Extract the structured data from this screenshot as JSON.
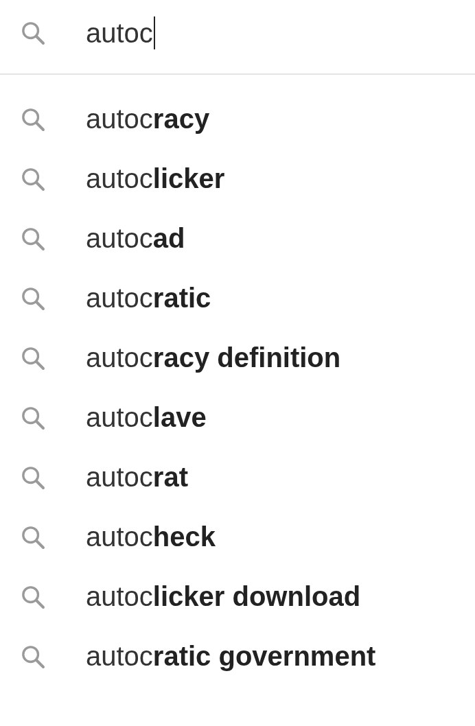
{
  "search": {
    "value": "autoc"
  },
  "suggestions": [
    "autoc**racy**",
    "autoc**licker**",
    "autoc**ad**",
    "autoc**ratic**",
    "autoc**racy definition**",
    "autoc**lave**",
    "autoc**rat**",
    "autoc**heck**",
    "autoc**licker download**",
    "autoc**ratic government**"
  ]
}
